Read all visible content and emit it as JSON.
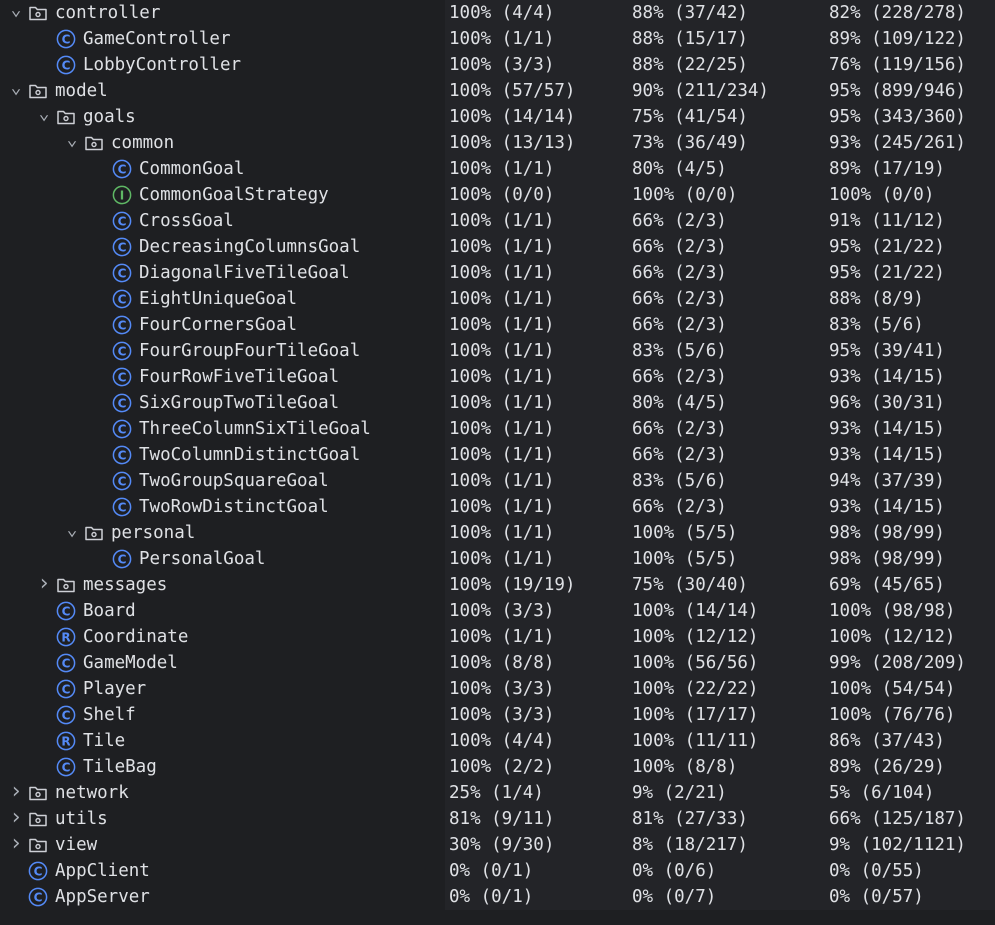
{
  "colors": {
    "background": "#1e1f22",
    "columns_background": "#232428",
    "class_icon": "#548af7",
    "interface_icon": "#5fb865",
    "folder_icon": "#ced0d6"
  },
  "rows": [
    {
      "name": "controller",
      "type": "folder",
      "depth": 0,
      "expand": "open",
      "c1": "100% (4/4)",
      "c2": "88% (37/42)",
      "c3": "82% (228/278)"
    },
    {
      "name": "GameController",
      "type": "class",
      "depth": 1,
      "expand": "none",
      "c1": "100% (1/1)",
      "c2": "88% (15/17)",
      "c3": "89% (109/122)"
    },
    {
      "name": "LobbyController",
      "type": "class",
      "depth": 1,
      "expand": "none",
      "c1": "100% (3/3)",
      "c2": "88% (22/25)",
      "c3": "76% (119/156)"
    },
    {
      "name": "model",
      "type": "folder",
      "depth": 0,
      "expand": "open",
      "c1": "100% (57/57)",
      "c2": "90% (211/234)",
      "c3": "95% (899/946)"
    },
    {
      "name": "goals",
      "type": "folder",
      "depth": 1,
      "expand": "open",
      "c1": "100% (14/14)",
      "c2": "75% (41/54)",
      "c3": "95% (343/360)"
    },
    {
      "name": "common",
      "type": "folder",
      "depth": 2,
      "expand": "open",
      "c1": "100% (13/13)",
      "c2": "73% (36/49)",
      "c3": "93% (245/261)"
    },
    {
      "name": "CommonGoal",
      "type": "class",
      "depth": 3,
      "expand": "none",
      "c1": "100% (1/1)",
      "c2": "80% (4/5)",
      "c3": "89% (17/19)"
    },
    {
      "name": "CommonGoalStrategy",
      "type": "interface",
      "depth": 3,
      "expand": "none",
      "c1": "100% (0/0)",
      "c2": "100% (0/0)",
      "c3": "100% (0/0)"
    },
    {
      "name": "CrossGoal",
      "type": "class",
      "depth": 3,
      "expand": "none",
      "c1": "100% (1/1)",
      "c2": "66% (2/3)",
      "c3": "91% (11/12)"
    },
    {
      "name": "DecreasingColumnsGoal",
      "type": "class",
      "depth": 3,
      "expand": "none",
      "c1": "100% (1/1)",
      "c2": "66% (2/3)",
      "c3": "95% (21/22)"
    },
    {
      "name": "DiagonalFiveTileGoal",
      "type": "class",
      "depth": 3,
      "expand": "none",
      "c1": "100% (1/1)",
      "c2": "66% (2/3)",
      "c3": "95% (21/22)"
    },
    {
      "name": "EightUniqueGoal",
      "type": "class",
      "depth": 3,
      "expand": "none",
      "c1": "100% (1/1)",
      "c2": "66% (2/3)",
      "c3": "88% (8/9)"
    },
    {
      "name": "FourCornersGoal",
      "type": "class",
      "depth": 3,
      "expand": "none",
      "c1": "100% (1/1)",
      "c2": "66% (2/3)",
      "c3": "83% (5/6)"
    },
    {
      "name": "FourGroupFourTileGoal",
      "type": "class",
      "depth": 3,
      "expand": "none",
      "c1": "100% (1/1)",
      "c2": "83% (5/6)",
      "c3": "95% (39/41)"
    },
    {
      "name": "FourRowFiveTileGoal",
      "type": "class",
      "depth": 3,
      "expand": "none",
      "c1": "100% (1/1)",
      "c2": "66% (2/3)",
      "c3": "93% (14/15)"
    },
    {
      "name": "SixGroupTwoTileGoal",
      "type": "class",
      "depth": 3,
      "expand": "none",
      "c1": "100% (1/1)",
      "c2": "80% (4/5)",
      "c3": "96% (30/31)"
    },
    {
      "name": "ThreeColumnSixTileGoal",
      "type": "class",
      "depth": 3,
      "expand": "none",
      "c1": "100% (1/1)",
      "c2": "66% (2/3)",
      "c3": "93% (14/15)"
    },
    {
      "name": "TwoColumnDistinctGoal",
      "type": "class",
      "depth": 3,
      "expand": "none",
      "c1": "100% (1/1)",
      "c2": "66% (2/3)",
      "c3": "93% (14/15)"
    },
    {
      "name": "TwoGroupSquareGoal",
      "type": "class",
      "depth": 3,
      "expand": "none",
      "c1": "100% (1/1)",
      "c2": "83% (5/6)",
      "c3": "94% (37/39)"
    },
    {
      "name": "TwoRowDistinctGoal",
      "type": "class",
      "depth": 3,
      "expand": "none",
      "c1": "100% (1/1)",
      "c2": "66% (2/3)",
      "c3": "93% (14/15)"
    },
    {
      "name": "personal",
      "type": "folder",
      "depth": 2,
      "expand": "open",
      "c1": "100% (1/1)",
      "c2": "100% (5/5)",
      "c3": "98% (98/99)"
    },
    {
      "name": "PersonalGoal",
      "type": "class",
      "depth": 3,
      "expand": "none",
      "c1": "100% (1/1)",
      "c2": "100% (5/5)",
      "c3": "98% (98/99)"
    },
    {
      "name": "messages",
      "type": "folder",
      "depth": 1,
      "expand": "closed",
      "c1": "100% (19/19)",
      "c2": "75% (30/40)",
      "c3": "69% (45/65)"
    },
    {
      "name": "Board",
      "type": "class",
      "depth": 1,
      "expand": "none",
      "c1": "100% (3/3)",
      "c2": "100% (14/14)",
      "c3": "100% (98/98)"
    },
    {
      "name": "Coordinate",
      "type": "record",
      "depth": 1,
      "expand": "none",
      "c1": "100% (1/1)",
      "c2": "100% (12/12)",
      "c3": "100% (12/12)"
    },
    {
      "name": "GameModel",
      "type": "class",
      "depth": 1,
      "expand": "none",
      "c1": "100% (8/8)",
      "c2": "100% (56/56)",
      "c3": "99% (208/209)"
    },
    {
      "name": "Player",
      "type": "class",
      "depth": 1,
      "expand": "none",
      "c1": "100% (3/3)",
      "c2": "100% (22/22)",
      "c3": "100% (54/54)"
    },
    {
      "name": "Shelf",
      "type": "class",
      "depth": 1,
      "expand": "none",
      "c1": "100% (3/3)",
      "c2": "100% (17/17)",
      "c3": "100% (76/76)"
    },
    {
      "name": "Tile",
      "type": "record",
      "depth": 1,
      "expand": "none",
      "c1": "100% (4/4)",
      "c2": "100% (11/11)",
      "c3": "86% (37/43)"
    },
    {
      "name": "TileBag",
      "type": "class",
      "depth": 1,
      "expand": "none",
      "c1": "100% (2/2)",
      "c2": "100% (8/8)",
      "c3": "89% (26/29)"
    },
    {
      "name": "network",
      "type": "folder",
      "depth": 0,
      "expand": "closed",
      "c1": "25% (1/4)",
      "c2": "9% (2/21)",
      "c3": "5% (6/104)"
    },
    {
      "name": "utils",
      "type": "folder",
      "depth": 0,
      "expand": "closed",
      "c1": "81% (9/11)",
      "c2": "81% (27/33)",
      "c3": "66% (125/187)"
    },
    {
      "name": "view",
      "type": "folder",
      "depth": 0,
      "expand": "closed",
      "c1": "30% (9/30)",
      "c2": "8% (18/217)",
      "c3": "9% (102/1121)"
    },
    {
      "name": "AppClient",
      "type": "class",
      "depth": 0,
      "expand": "none",
      "c1": "0% (0/1)",
      "c2": "0% (0/6)",
      "c3": "0% (0/55)"
    },
    {
      "name": "AppServer",
      "type": "class",
      "depth": 0,
      "expand": "none",
      "c1": "0% (0/1)",
      "c2": "0% (0/7)",
      "c3": "0% (0/57)"
    }
  ]
}
